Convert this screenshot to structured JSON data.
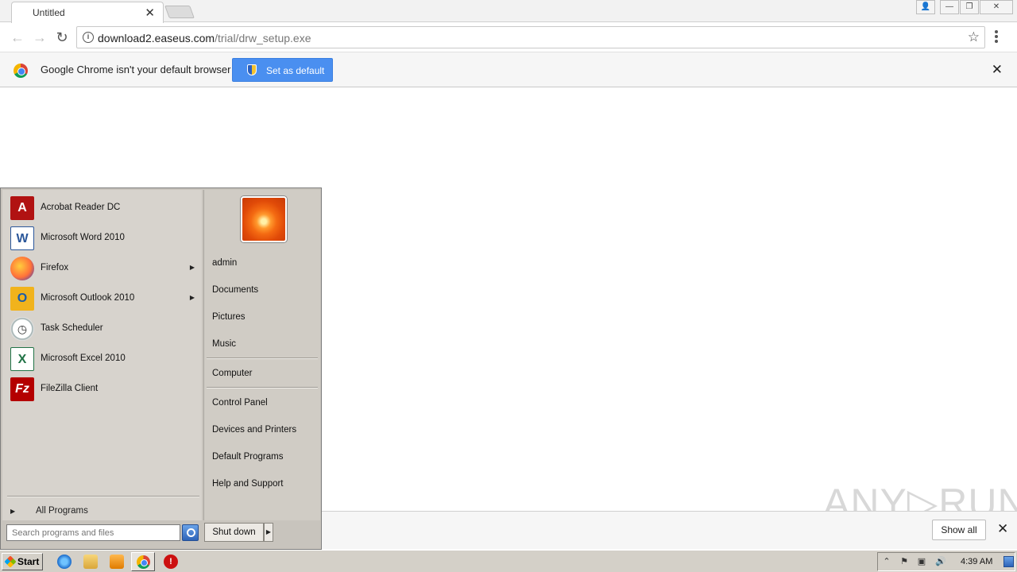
{
  "browser": {
    "tab_title": "Untitled",
    "tab_close": "✕",
    "url_host": "download2.easeus.com",
    "url_path": "/trial/drw_setup.exe",
    "window_controls": {
      "user": "👤",
      "minimize": "—",
      "restore": "❐",
      "close": "✕"
    }
  },
  "infobar": {
    "message": "Google Chrome isn't your default browser",
    "set_default_label": "Set as default",
    "close": "✕"
  },
  "download_shelf": {
    "show_all_label": "Show all",
    "close": "✕"
  },
  "watermark": "ANY▷RUN",
  "start_menu": {
    "programs": [
      {
        "label": "Acrobat Reader DC",
        "icon": "acrobat-icon",
        "glyph": "A"
      },
      {
        "label": "Microsoft Word 2010",
        "icon": "word-icon",
        "glyph": "W"
      },
      {
        "label": "Firefox",
        "icon": "firefox-icon",
        "glyph": "",
        "has_submenu": true
      },
      {
        "label": "Microsoft Outlook 2010",
        "icon": "outlook-icon",
        "glyph": "O",
        "has_submenu": true
      },
      {
        "label": "Task Scheduler",
        "icon": "task-scheduler-icon",
        "glyph": "◷"
      },
      {
        "label": "Microsoft Excel 2010",
        "icon": "excel-icon",
        "glyph": "X"
      },
      {
        "label": "FileZilla Client",
        "icon": "filezilla-icon",
        "glyph": "Fz"
      }
    ],
    "submenu_arrow": "▶",
    "all_programs_arrow": "▶",
    "all_programs_label": "All Programs",
    "search_placeholder": "Search programs and files",
    "shutdown_label": "Shut down",
    "shutdown_arrow": "▶",
    "right_items_group1": [
      "admin",
      "Documents",
      "Pictures",
      "Music"
    ],
    "right_items_group2": [
      "Computer"
    ],
    "right_items_group3": [
      "Control Panel",
      "Devices and Printers",
      "Default Programs",
      "Help and Support"
    ]
  },
  "taskbar": {
    "start_label": "Start",
    "stop_glyph": "!",
    "tray_up_arrow": "⌃",
    "tray_flag": "⚑",
    "tray_network": "▣",
    "tray_volume": "🔊",
    "clock": "4:39 AM"
  }
}
